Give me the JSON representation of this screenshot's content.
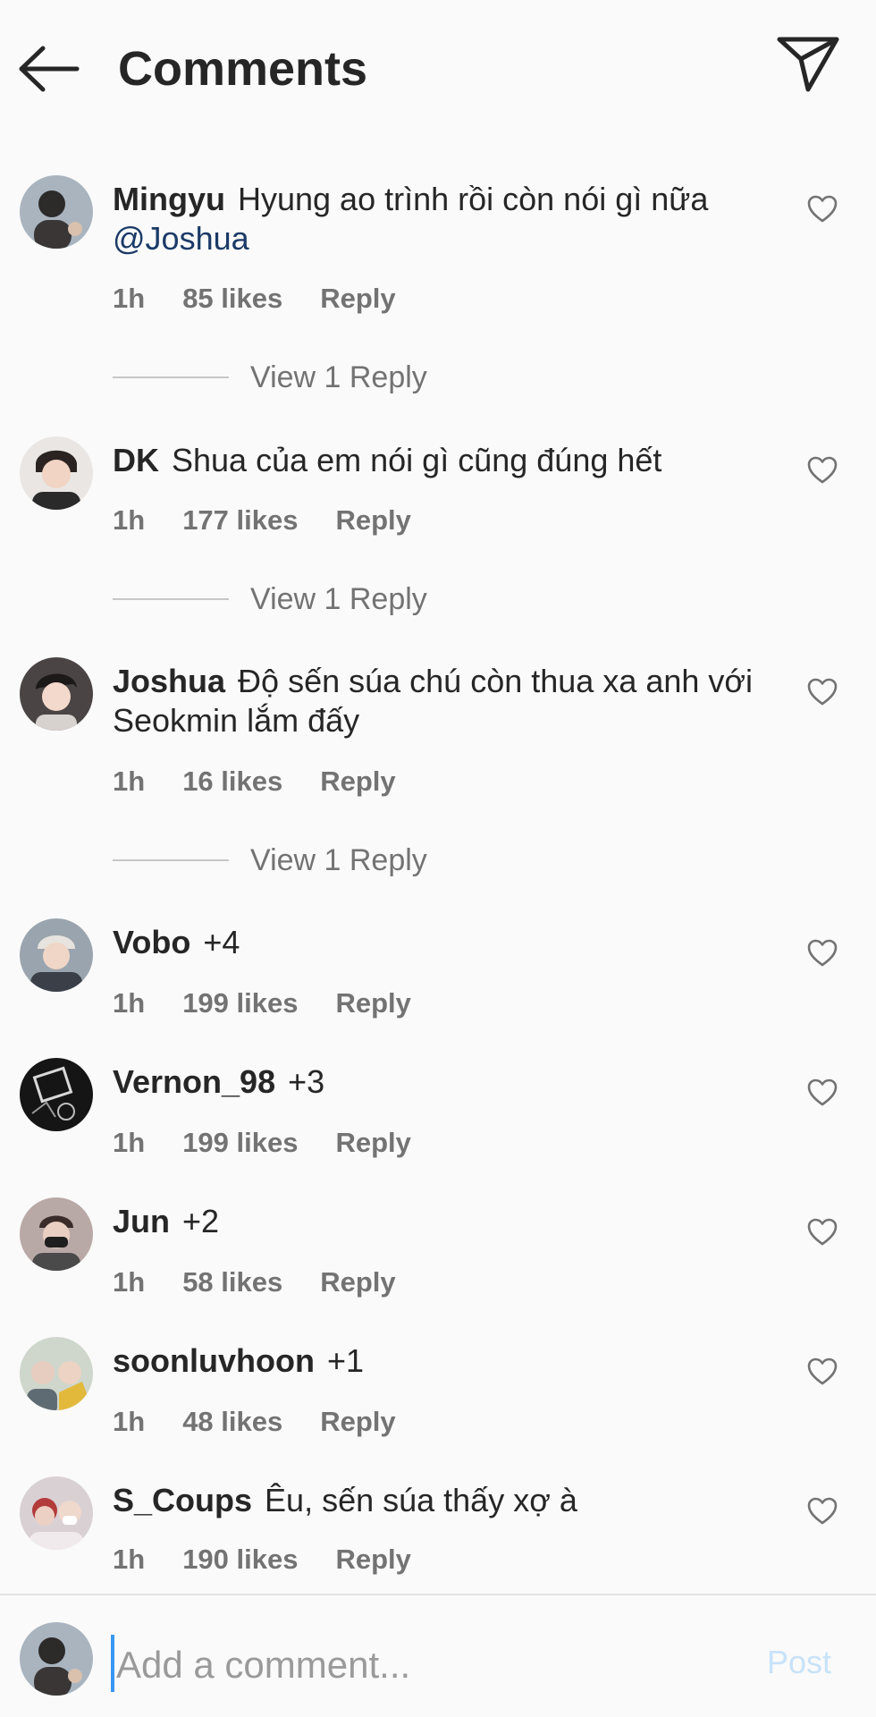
{
  "header": {
    "title": "Comments",
    "back_icon": "arrow-left-icon",
    "share_icon": "paper-plane-icon"
  },
  "colors": {
    "background": "#fafafa",
    "text": "#262626",
    "muted": "#737373",
    "mention": "#1b3a67",
    "post_disabled": "#c8e2f9",
    "caret": "#3897f0"
  },
  "comments": [
    {
      "username": "Mingyu",
      "text": "Hyung ao trình rồi còn nói gì nữa",
      "mention": "@Joshua",
      "time": "1h",
      "likes": "85 likes",
      "reply": "Reply",
      "view_replies": "View 1 Reply"
    },
    {
      "username": "DK",
      "text": "Shua của em nói gì cũng đúng hết",
      "time": "1h",
      "likes": "177 likes",
      "reply": "Reply",
      "view_replies": "View 1 Reply"
    },
    {
      "username": "Joshua",
      "text": "Độ sến súa chú còn thua xa anh với Seokmin lắm đấy",
      "time": "1h",
      "likes": "16 likes",
      "reply": "Reply",
      "view_replies": "View 1 Reply"
    },
    {
      "username": "Vobo",
      "text": "+4",
      "time": "1h",
      "likes": "199 likes",
      "reply": "Reply"
    },
    {
      "username": "Vernon_98",
      "text": "+3",
      "time": "1h",
      "likes": "199 likes",
      "reply": "Reply"
    },
    {
      "username": "Jun",
      "text": "+2",
      "time": "1h",
      "likes": "58 likes",
      "reply": "Reply"
    },
    {
      "username": "soonluvhoon",
      "text": "+1",
      "time": "1h",
      "likes": "48 likes",
      "reply": "Reply"
    },
    {
      "username": "S_Coups",
      "text": "Êu, sến súa thấy xợ à",
      "time": "1h",
      "likes": "190 likes",
      "reply": "Reply"
    }
  ],
  "composer": {
    "placeholder": "Add a comment...",
    "post_label": "Post"
  }
}
